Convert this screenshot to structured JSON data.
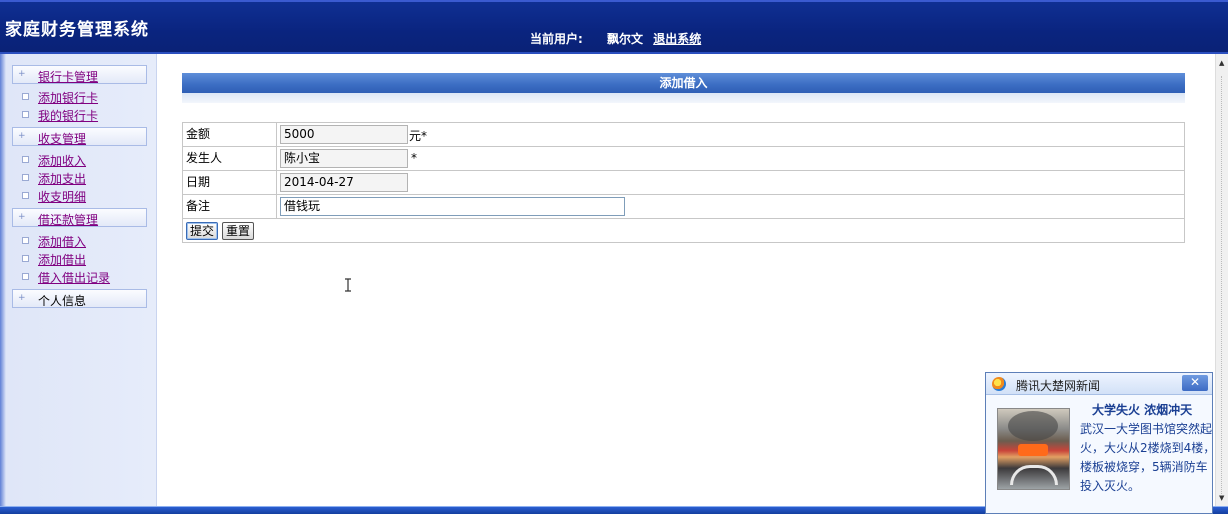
{
  "header": {
    "app_title": "家庭财务管理系统",
    "current_user_label": "当前用户:",
    "user_name": "飘尔文",
    "logout": "退出系统"
  },
  "sidebar": {
    "groups": [
      {
        "label": "银行卡管理",
        "items": [
          "添加银行卡",
          "我的银行卡"
        ]
      },
      {
        "label": "收支管理",
        "items": [
          "添加收入",
          "添加支出",
          "收支明细"
        ]
      },
      {
        "label": "借还款管理",
        "items": [
          "添加借入",
          "添加借出",
          "借入借出记录"
        ]
      },
      {
        "label": "个人信息",
        "items": []
      }
    ]
  },
  "main": {
    "panel_title": "添加借入",
    "form": {
      "amount_label": "金额",
      "amount_value": "5000",
      "amount_suffix": "元*",
      "person_label": "发生人",
      "person_value": "陈小宝",
      "person_suffix": "*",
      "date_label": "日期",
      "date_value": "2014-04-27",
      "note_label": "备注",
      "note_value": "借钱玩",
      "submit": "提交",
      "reset": "重置"
    }
  },
  "news_popup": {
    "source": "腾讯大楚网新闻",
    "close": "✕",
    "headline": "大学失火 浓烟冲天",
    "body_lines": [
      "武汉一大学图书馆突然起",
      "火，大火从2楼烧到4楼，",
      "楼板被烧穿，5辆消防车",
      "投入灭火。"
    ]
  },
  "colors": {
    "header_bg": "#0a247f",
    "panel_title_bg": "#3d6fc4",
    "link_visited": "#800080"
  }
}
